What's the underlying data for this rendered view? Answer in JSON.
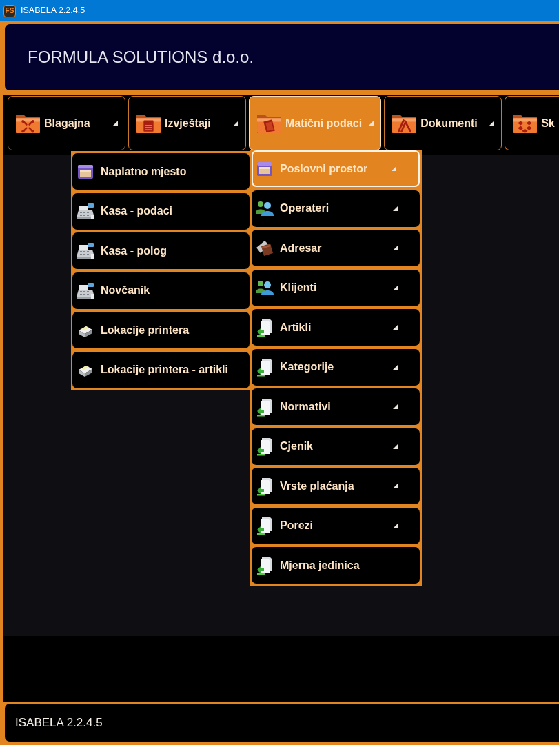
{
  "window": {
    "logo": "FS",
    "title": "ISABELA 2.2.4.5"
  },
  "header": {
    "company": "FORMULA SOLUTIONS d.o.o."
  },
  "menu_bar": [
    {
      "label": "Blagajna",
      "selected": false,
      "has_submenu": true
    },
    {
      "label": "Izvještaji",
      "selected": false,
      "has_submenu": true
    },
    {
      "label": "Matični podaci",
      "selected": true,
      "has_submenu": true
    },
    {
      "label": "Dokumenti",
      "selected": false,
      "has_submenu": true
    },
    {
      "label": "Sk",
      "selected": false
    }
  ],
  "dropdown": {
    "items": [
      {
        "label": "Poslovni prostor",
        "selected": true,
        "has_submenu": true
      },
      {
        "label": "Operateri",
        "selected": false,
        "has_submenu": true
      },
      {
        "label": "Adresar",
        "selected": false,
        "has_submenu": true
      },
      {
        "label": "Klijenti",
        "selected": false,
        "has_submenu": true
      },
      {
        "label": "Artikli",
        "selected": false,
        "has_submenu": true
      },
      {
        "label": "Kategorije",
        "selected": false,
        "has_submenu": true
      },
      {
        "label": "Normativi",
        "selected": false,
        "has_submenu": true
      },
      {
        "label": "Cjenik",
        "selected": false,
        "has_submenu": true
      },
      {
        "label": "Vrste plaćanja",
        "selected": false,
        "has_submenu": true
      },
      {
        "label": "Porezi",
        "selected": false,
        "has_submenu": true
      },
      {
        "label": "Mjerna jedinica",
        "selected": false,
        "has_submenu": false
      }
    ]
  },
  "flyout": {
    "items": [
      {
        "label": "Naplatno mjesto",
        "selected": false
      },
      {
        "label": "Kasa - podaci",
        "selected": false
      },
      {
        "label": "Kasa - polog",
        "selected": false
      },
      {
        "label": "Novčanik",
        "selected": false
      },
      {
        "label": "Lokacije printera",
        "selected": false
      },
      {
        "label": "Lokacije printera - artikli",
        "selected": false
      }
    ]
  },
  "status_bar": {
    "text": "ISABELA 2.2.4.5"
  }
}
